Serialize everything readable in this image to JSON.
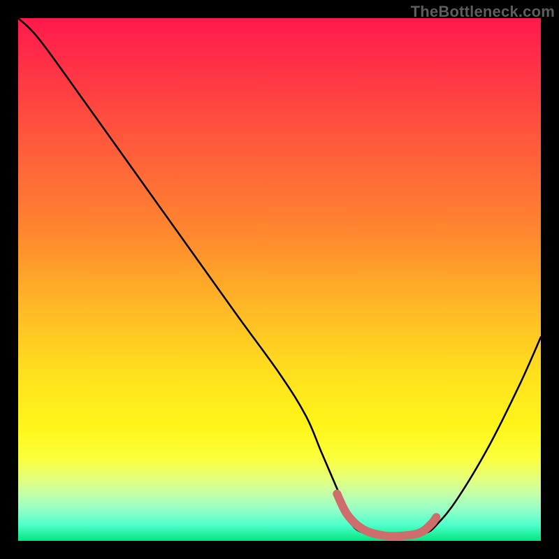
{
  "watermark": "TheBottleneck.com",
  "chart_data": {
    "type": "line",
    "title": "",
    "xlabel": "",
    "ylabel": "",
    "xlim": [
      0,
      100
    ],
    "ylim": [
      0,
      100
    ],
    "grid": false,
    "series": [
      {
        "name": "main-curve",
        "color": "#000000",
        "x": [
          0,
          4,
          12,
          22,
          32,
          42,
          50,
          55,
          58,
          61,
          63,
          65,
          70,
          75,
          78,
          80,
          84,
          90,
          96,
          100
        ],
        "y": [
          100,
          96,
          85,
          71,
          57,
          43,
          32,
          24,
          17,
          10,
          5,
          2,
          0.8,
          0.8,
          1.5,
          3,
          8,
          18,
          30,
          39
        ]
      },
      {
        "name": "highlight-band",
        "color": "#cf6d6d",
        "x": [
          61,
          63,
          66,
          70,
          74,
          77,
          79,
          80
        ],
        "y": [
          9,
          5,
          2.2,
          1.0,
          1.0,
          1.6,
          3.2,
          4.5
        ]
      }
    ],
    "gradient_stops": [
      {
        "pos": 0,
        "color": "#ff1a4b"
      },
      {
        "pos": 18,
        "color": "#ff4a3f"
      },
      {
        "pos": 42,
        "color": "#ff8a2e"
      },
      {
        "pos": 68,
        "color": "#ffe01e"
      },
      {
        "pos": 88,
        "color": "#e6ff79"
      },
      {
        "pos": 100,
        "color": "#00e77f"
      }
    ]
  }
}
